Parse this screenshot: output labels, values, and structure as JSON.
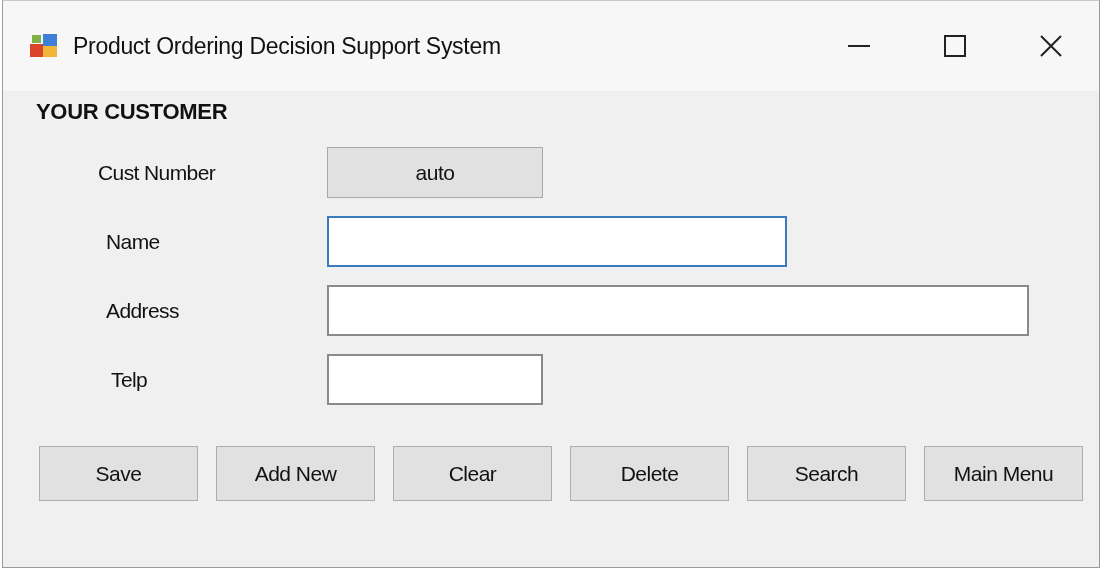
{
  "window": {
    "title": "Product Ordering Decision Support System"
  },
  "heading": "YOUR CUSTOMER",
  "fields": [
    {
      "label": "Cust Number",
      "kind": "display",
      "value": "auto"
    },
    {
      "label": "Name",
      "kind": "input",
      "focused": true
    },
    {
      "label": "Address",
      "kind": "input",
      "focused": false
    },
    {
      "label": "Telp",
      "kind": "input",
      "focused": false
    }
  ],
  "buttons": [
    "Save",
    "Add New",
    "Clear",
    "Delete",
    "Search",
    "Main Menu"
  ]
}
